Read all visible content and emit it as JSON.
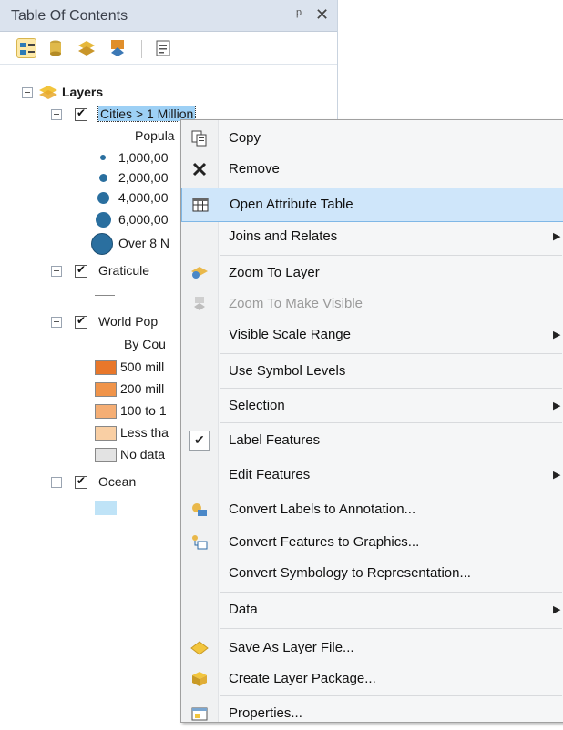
{
  "toc": {
    "title": "Table Of Contents",
    "pin": "ᵖ",
    "close": "✕"
  },
  "tree": {
    "root": "Layers",
    "cities": {
      "name": "Cities > 1 Million",
      "field": "Popula",
      "classes": [
        "1,000,00",
        "2,000,00",
        "4,000,00",
        "6,000,00",
        "Over 8 N"
      ]
    },
    "graticule": {
      "name": "Graticule"
    },
    "world": {
      "name": "World Pop",
      "field": "By Cou",
      "classes": [
        {
          "label": "500 mill",
          "color": "#e8772a"
        },
        {
          "label": "200 mill",
          "color": "#f0944a"
        },
        {
          "label": "100 to 1",
          "color": "#f5ae74"
        },
        {
          "label": "Less tha",
          "color": "#f9cfa4"
        },
        {
          "label": "No data",
          "color": "#e3e3e3"
        }
      ]
    },
    "ocean": {
      "name": "Ocean",
      "color": "#bfe3f7"
    }
  },
  "menu": {
    "items": [
      {
        "label": "Copy"
      },
      {
        "label": "Remove"
      },
      {
        "label": "Open Attribute Table"
      },
      {
        "label": "Joins and Relates"
      },
      {
        "label": "Zoom To Layer"
      },
      {
        "label": "Zoom To Make Visible"
      },
      {
        "label": "Visible Scale Range"
      },
      {
        "label": "Use Symbol Levels"
      },
      {
        "label": "Selection"
      },
      {
        "label": "Label Features"
      },
      {
        "label": "Edit Features"
      },
      {
        "label": "Convert Labels to Annotation..."
      },
      {
        "label": "Convert Features to Graphics..."
      },
      {
        "label": "Convert Symbology to Representation..."
      },
      {
        "label": "Data"
      },
      {
        "label": "Save As Layer File..."
      },
      {
        "label": "Create Layer Package..."
      },
      {
        "label": "Properties..."
      }
    ],
    "arrow": "▶"
  }
}
